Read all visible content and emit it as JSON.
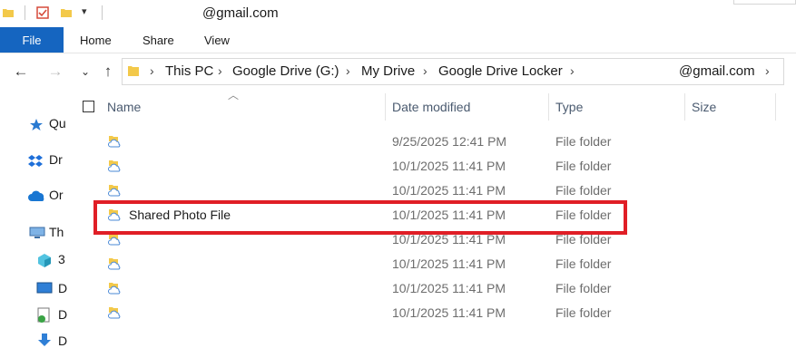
{
  "window": {
    "title": "@gmail.com"
  },
  "ribbon": {
    "file_label": "File",
    "tabs": [
      "Home",
      "Share",
      "View"
    ]
  },
  "address": {
    "crumbs": [
      "This PC",
      "Google Drive (G:)",
      "My Drive",
      "Google Drive Locker",
      "@gmail.com"
    ]
  },
  "nav": {
    "items": [
      {
        "label": "Qu",
        "icon": "star-icon"
      },
      {
        "label": "Dr",
        "icon": "dropbox-icon"
      },
      {
        "label": "Or",
        "icon": "onedrive-icon"
      },
      {
        "label": "Th",
        "icon": "pc-icon"
      },
      {
        "label": "3",
        "icon": "3d-objects-icon"
      },
      {
        "label": "D",
        "icon": "desktop-icon"
      },
      {
        "label": "D",
        "icon": "documents-icon"
      },
      {
        "label": "D",
        "icon": "downloads-icon"
      }
    ]
  },
  "columns": {
    "name": "Name",
    "date": "Date modified",
    "type": "Type",
    "size": "Size"
  },
  "files": [
    {
      "name": "",
      "date": "9/25/2025 12:41 PM",
      "type": "File folder"
    },
    {
      "name": "",
      "date": "10/1/2025 11:41 PM",
      "type": "File folder"
    },
    {
      "name": "",
      "date": "10/1/2025 11:41 PM",
      "type": "File folder"
    },
    {
      "name": "Shared Photo File",
      "date": "10/1/2025 11:41 PM",
      "type": "File folder"
    },
    {
      "name": "",
      "date": "10/1/2025 11:41 PM",
      "type": "File folder"
    },
    {
      "name": "",
      "date": "10/1/2025 11:41 PM",
      "type": "File folder"
    },
    {
      "name": "",
      "date": "10/1/2025 11:41 PM",
      "type": "File folder"
    },
    {
      "name": "",
      "date": "10/1/2025 11:41 PM",
      "type": "File folder"
    }
  ],
  "colors": {
    "accent": "#1565c0",
    "highlight": "#e01e26",
    "folder": "#f3c94a"
  }
}
